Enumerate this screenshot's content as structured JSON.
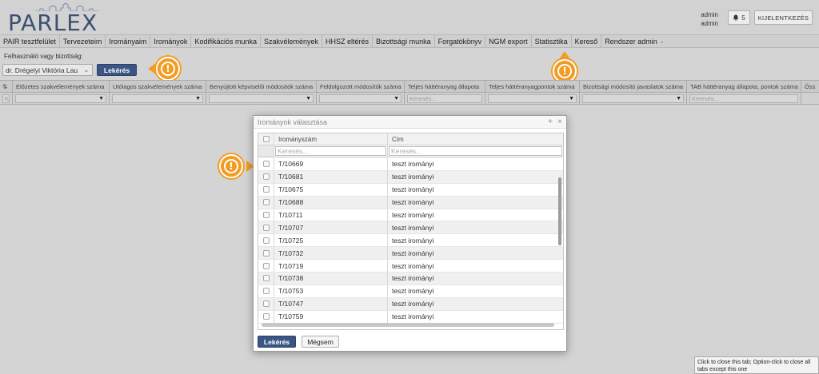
{
  "app": {
    "logo_text": "PARLEX",
    "user_name": "admin",
    "user_role": "admin",
    "notification_count": "5",
    "logout_label": "KIJELENTKEZÉS"
  },
  "menu": [
    {
      "label": "PAIR tesztfelület"
    },
    {
      "label": "Tervezeteim"
    },
    {
      "label": "Irományaim"
    },
    {
      "label": "Irományok"
    },
    {
      "label": "Kodifikációs munka"
    },
    {
      "label": "Szakvélemények"
    },
    {
      "label": "HHSZ eltérés"
    },
    {
      "label": "Bizottsági munka"
    },
    {
      "label": "Forgatókönyv"
    },
    {
      "label": "NGM export"
    },
    {
      "label": "Statisztika"
    },
    {
      "label": "Kereső"
    },
    {
      "label": "Rendszer admin"
    }
  ],
  "filter": {
    "label": "Felhasználó vagy bizottság:",
    "selected_user": "dr. Drégelyi Viktória Lau",
    "submit_label": "Lekérés"
  },
  "grid": {
    "columns": [
      "Előzetes szakvélemények száma",
      "Utólagos szakvélemények száma",
      "Benyújtott képviselői módosítók száma",
      "Feldolgozott módosítók száma",
      "Teljes háttéranyag állapota",
      "Teljes háttéranyagpontok száma",
      "Bizottsági módosító javaslatok száma",
      "TAB háttéranyag állapota, pontok száma",
      "Öss"
    ],
    "filter_placeholder": "Keresés...",
    "first_filter_text": "Ke"
  },
  "modal": {
    "title": "Irományok választása",
    "col_number": "Irományszám",
    "col_title": "Cím",
    "search_placeholder": "Keresés...",
    "rows": [
      {
        "number": "T/10669",
        "title": "teszt irományi"
      },
      {
        "number": "T/10681",
        "title": "teszt irományi"
      },
      {
        "number": "T/10675",
        "title": "teszt irományi"
      },
      {
        "number": "T/10688",
        "title": "teszt irományi"
      },
      {
        "number": "T/10711",
        "title": "teszt irományi"
      },
      {
        "number": "T/10707",
        "title": "teszt irományi"
      },
      {
        "number": "T/10725",
        "title": "teszt irományi"
      },
      {
        "number": "T/10732",
        "title": "teszt irományi"
      },
      {
        "number": "T/10719",
        "title": "teszt irományi"
      },
      {
        "number": "T/10738",
        "title": "teszt irományi"
      },
      {
        "number": "T/10753",
        "title": "teszt irományi"
      },
      {
        "number": "T/10747",
        "title": "teszt irományi"
      },
      {
        "number": "T/10759",
        "title": "teszt irományi"
      }
    ],
    "submit_label": "Lekérés",
    "cancel_label": "Mégsem"
  },
  "tooltip": {
    "text": "Click to close this tab; Option-click to close all tabs except this one"
  },
  "colors": {
    "accent": "#3b5585",
    "hint": "#f39c23",
    "logo": "#3a4f72"
  },
  "icons": {
    "notification": "bell-icon",
    "hint": "exclamation-icon",
    "dropdown": "chevron-down-icon",
    "close": "close-icon",
    "maximize": "plus-icon"
  }
}
